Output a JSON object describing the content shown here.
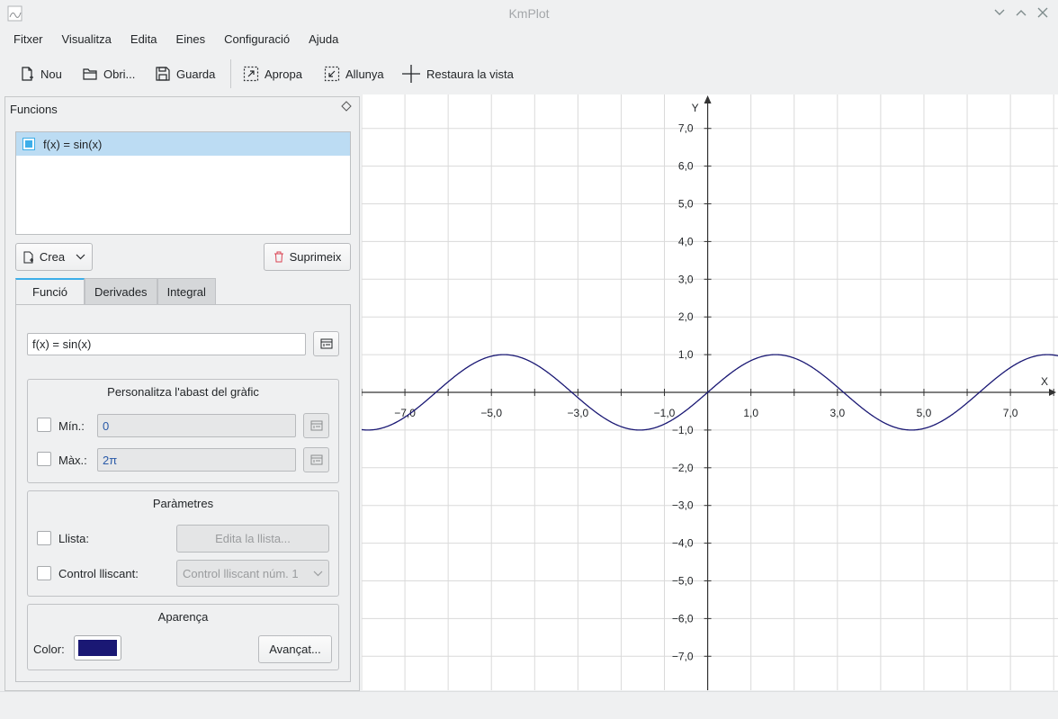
{
  "window": {
    "title": "KmPlot"
  },
  "menubar": [
    "Fitxer",
    "Visualitza",
    "Edita",
    "Eines",
    "Configuració",
    "Ajuda"
  ],
  "toolbar": {
    "new": "Nou",
    "open": "Obri...",
    "save": "Guarda",
    "zoom_in": "Apropa",
    "zoom_out": "Allunya",
    "reset_view": "Restaura la vista"
  },
  "functions_panel": {
    "title": "Funcions",
    "items": [
      {
        "label": "f(x) = sin(x)",
        "checked": true
      }
    ],
    "create_button": "Crea",
    "delete_button": "Suprimeix",
    "tabs": [
      "Funció",
      "Derivades",
      "Integral"
    ],
    "active_tab": "Funció",
    "equation": "f(x) = sin(x)",
    "range_group": {
      "title": "Personalitza l'abast del gràfic",
      "min_label": "Mín.:",
      "min_value": "0",
      "max_label": "Màx.:",
      "max_value": "2π"
    },
    "params_group": {
      "title": "Paràmetres",
      "list_label": "Llista:",
      "edit_list_button": "Edita la llista...",
      "slider_label": "Control lliscant:",
      "slider_select": "Control lliscant núm. 1"
    },
    "appearance_group": {
      "title": "Aparença",
      "color_label": "Color:",
      "color": "#1a1874",
      "advanced_button": "Avançat..."
    }
  },
  "chart_data": {
    "type": "line",
    "x_axis_label": "X",
    "y_axis_label": "Y",
    "xlim": [
      -8.0,
      8.1
    ],
    "ylim": [
      -7.9,
      7.9
    ],
    "x_ticks": [
      -7.0,
      -5.0,
      -3.0,
      -1.0,
      1.0,
      3.0,
      5.0,
      7.0
    ],
    "x_tick_labels": [
      "−7,0",
      "−5,0",
      "−3,0",
      "−1,0",
      "1,0",
      "3,0",
      "5,0",
      "7,0"
    ],
    "y_ticks": [
      7,
      6,
      5,
      4,
      3,
      2,
      1,
      -1,
      -2,
      -3,
      -4,
      -5,
      -6,
      -7
    ],
    "y_tick_labels": [
      "7,0",
      "6,0",
      "5,0",
      "4,0",
      "3,0",
      "2,0",
      "1,0",
      "−1,0",
      "−2,0",
      "−3,0",
      "−4,0",
      "−5,0",
      "−6,0",
      "−7,0"
    ],
    "grid": true,
    "series": [
      {
        "name": "f(x) = sin(x)",
        "function": "sin",
        "color": "#1a1874"
      }
    ]
  }
}
